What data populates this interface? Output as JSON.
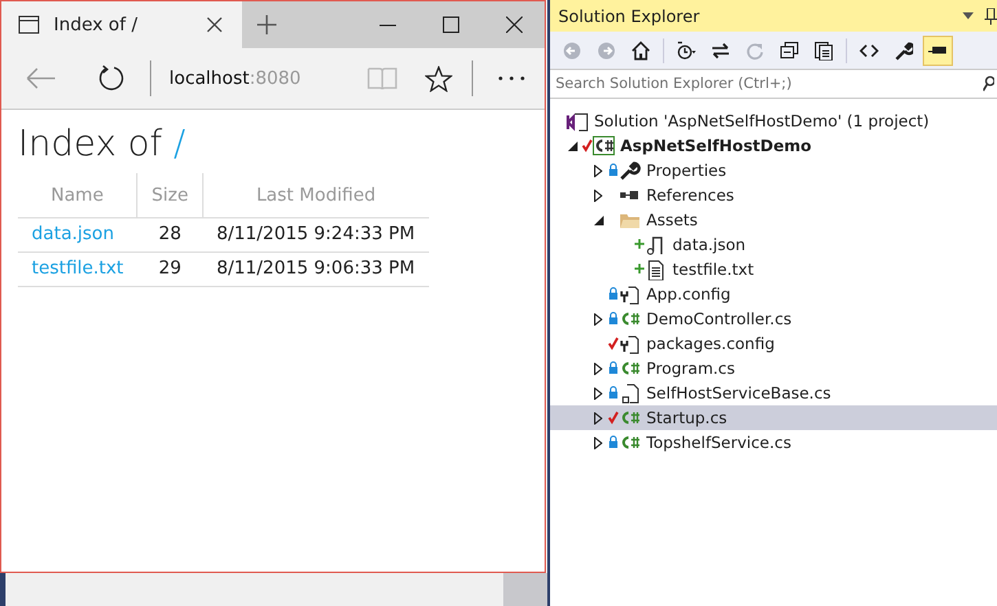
{
  "browser": {
    "tab_title": "Index of /",
    "address_host": "localhost",
    "address_port": ":8080",
    "heading": "Index of ",
    "heading_link": "/",
    "table": {
      "columns": [
        "Name",
        "Size",
        "Last Modified"
      ],
      "rows": [
        {
          "name": "data.json",
          "size": "28",
          "modified": "8/11/2015 9:24:33 PM"
        },
        {
          "name": "testfile.txt",
          "size": "29",
          "modified": "8/11/2015 9:06:33 PM"
        }
      ]
    }
  },
  "solution_explorer": {
    "title": "Solution Explorer",
    "search": {
      "placeholder": "Search Solution Explorer (Ctrl+;)"
    },
    "toolbar": [
      {
        "kind": "back",
        "disabled": true
      },
      {
        "kind": "forward",
        "disabled": true
      },
      {
        "kind": "home",
        "disabled": false
      },
      {
        "kind": "history",
        "disabled": false
      },
      {
        "kind": "sync",
        "disabled": false
      },
      {
        "kind": "refresh",
        "disabled": true
      },
      {
        "kind": "collapse",
        "disabled": false
      },
      {
        "kind": "showall",
        "disabled": false
      },
      {
        "kind": "code",
        "disabled": false
      },
      {
        "kind": "properties",
        "disabled": false
      },
      {
        "kind": "preview",
        "disabled": false,
        "selected": true
      }
    ],
    "tree": [
      {
        "label": "Solution 'AspNetSelfHostDemo' (1 project)",
        "kind": "solution",
        "locked": false,
        "checked_out": false,
        "added": false,
        "selected": false,
        "children": [
          {
            "label": "AspNetSelfHostDemo",
            "kind": "project",
            "locked": false,
            "checked_out": true,
            "added": false,
            "expanded": true,
            "selected": false,
            "children": [
              {
                "label": "Properties",
                "kind": "wrench",
                "locked": true,
                "checked_out": false,
                "added": false,
                "expanded": false,
                "selected": false
              },
              {
                "label": "References",
                "kind": "references",
                "locked": false,
                "checked_out": false,
                "added": false,
                "expanded": false,
                "selected": false
              },
              {
                "label": "Assets",
                "kind": "folder",
                "locked": false,
                "checked_out": false,
                "added": false,
                "expanded": true,
                "selected": false,
                "children": [
                  {
                    "label": "data.json",
                    "kind": "json",
                    "locked": false,
                    "checked_out": false,
                    "added": true,
                    "selected": false
                  },
                  {
                    "label": "testfile.txt",
                    "kind": "text",
                    "locked": false,
                    "checked_out": false,
                    "added": true,
                    "selected": false
                  }
                ]
              },
              {
                "label": "App.config",
                "kind": "config",
                "locked": true,
                "checked_out": false,
                "added": false,
                "selected": false
              },
              {
                "label": "DemoController.cs",
                "kind": "csharp",
                "locked": true,
                "checked_out": false,
                "added": false,
                "expanded": false,
                "selected": false
              },
              {
                "label": "packages.config",
                "kind": "config",
                "locked": false,
                "checked_out": true,
                "added": false,
                "selected": false
              },
              {
                "label": "Program.cs",
                "kind": "csharp",
                "locked": true,
                "checked_out": false,
                "added": false,
                "expanded": false,
                "selected": false
              },
              {
                "label": "SelfHostServiceBase.cs",
                "kind": "file",
                "locked": true,
                "checked_out": false,
                "added": false,
                "expanded": false,
                "selected": false
              },
              {
                "label": "Startup.cs",
                "kind": "csharp",
                "locked": false,
                "checked_out": true,
                "added": false,
                "expanded": false,
                "selected": true
              },
              {
                "label": "TopshelfService.cs",
                "kind": "csharp",
                "locked": true,
                "checked_out": false,
                "added": false,
                "expanded": false,
                "selected": false
              }
            ]
          }
        ]
      }
    ]
  }
}
